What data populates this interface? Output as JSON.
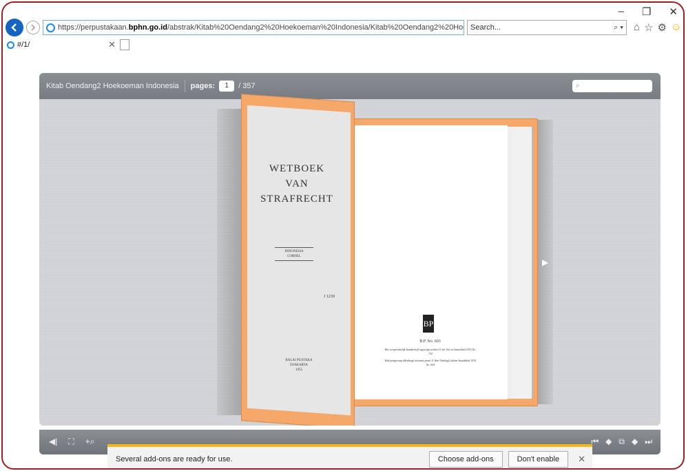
{
  "window": {
    "minimize": "–",
    "restore": "❐",
    "close": "✕"
  },
  "address": {
    "prefix": "https://perpustakaan.",
    "domain": "bphn.go.id",
    "path": "/abstrak/Kitab%20Oendang2%20Hoekoeman%20Indonesia/Kitab%20Oendang2%20Hoekoeman%20Indonesia.l",
    "controls": "▾ 🔒 ↻"
  },
  "search": {
    "placeholder": "Search...",
    "icon": "⌕ ▾"
  },
  "toolbar_icons": [
    "⌂",
    "☆",
    "⚙",
    "☺"
  ],
  "tab": {
    "label": "#/1/",
    "close": "✕"
  },
  "viewer": {
    "title": "Kitab Oendang2 Hoekoeman Indonesia",
    "pages_label": "pages:",
    "current_page": "1",
    "total_pages": "/ 357",
    "search_icon": "⌕"
  },
  "book": {
    "left_title_line1": "WETBOEK",
    "left_title_line2": "VAN STRAFRECHT",
    "stamp_line1": "INDONESIA",
    "stamp_line2": "CORNEL",
    "code": "J 1239",
    "publisher_line1": "BALAI PUSTAKA",
    "publisher_line2": "DJAKARTA",
    "publisher_line3": "1955",
    "logo": "BP",
    "bp_no": "B.P. No. 603",
    "pub1": "Het oorspronkelijk handschrift ingevolge artikel 11 der Wet in Staatsblad 1915 No. 732",
    "pub2": "Hak pengarang dilindungi menurut pasal 11 dari Ondang2 dalam Staatsblad 1915 No. 603"
  },
  "bottom_tools": {
    "left": [
      "◀|",
      "⛶",
      "+⌕"
    ],
    "right": [
      "⏮",
      "◆",
      "⧉",
      "◆",
      "⏭"
    ]
  },
  "notification": {
    "text": "Several add-ons are ready for use.",
    "choose": "Choose add-ons",
    "dont": "Don't enable",
    "close": "✕"
  },
  "colors": {
    "accent": "#f5a86a",
    "frame": "#9b1c22",
    "ie_blue": "#1565c0",
    "notif_bar": "#f5b61a"
  }
}
